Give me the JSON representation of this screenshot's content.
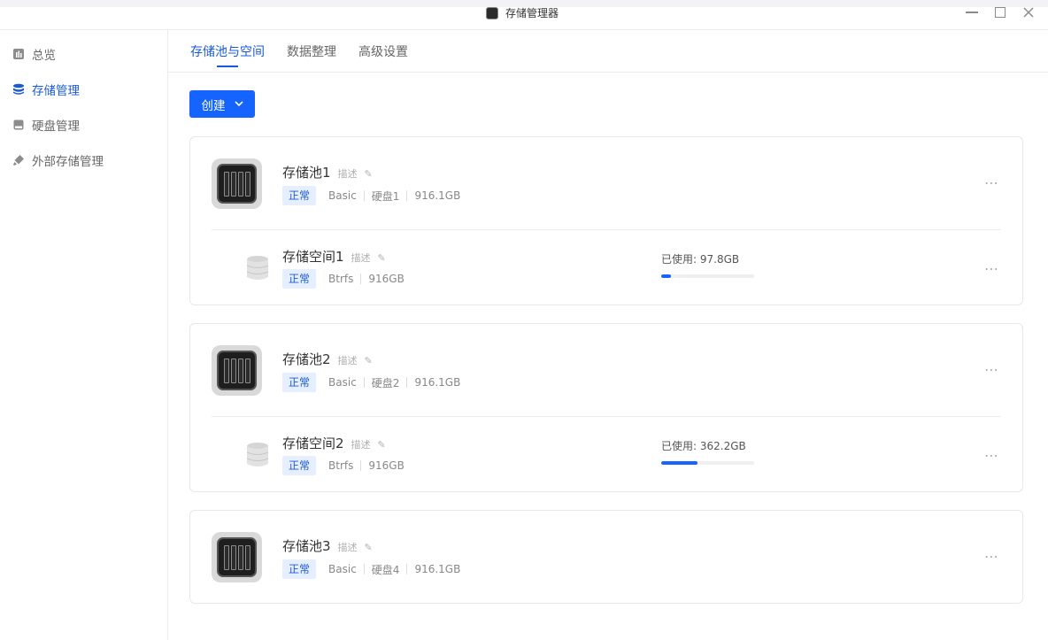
{
  "window": {
    "title": "存储管理器"
  },
  "sidebar": {
    "items": [
      {
        "label": "总览",
        "icon": "chart-icon",
        "active": false
      },
      {
        "label": "存储管理",
        "icon": "database-icon",
        "active": true
      },
      {
        "label": "硬盘管理",
        "icon": "disk-icon",
        "active": false
      },
      {
        "label": "外部存储管理",
        "icon": "usb-icon",
        "active": false
      }
    ]
  },
  "tabs": [
    {
      "label": "存储池与空间",
      "active": true
    },
    {
      "label": "数据整理",
      "active": false
    },
    {
      "label": "高级设置",
      "active": false
    }
  ],
  "toolbar": {
    "create_label": "创建"
  },
  "pools": [
    {
      "name": "存储池1",
      "desc": "描述",
      "status": "正常",
      "raid": "Basic",
      "disks": "硬盘1",
      "size": "916.1GB",
      "volume": {
        "name": "存储空间1",
        "desc": "描述",
        "status": "正常",
        "fs": "Btrfs",
        "size": "916GB",
        "used_label": "已使用: 97.8GB",
        "used_fraction": 0.107
      }
    },
    {
      "name": "存储池2",
      "desc": "描述",
      "status": "正常",
      "raid": "Basic",
      "disks": "硬盘2",
      "size": "916.1GB",
      "volume": {
        "name": "存储空间2",
        "desc": "描述",
        "status": "正常",
        "fs": "Btrfs",
        "size": "916GB",
        "used_label": "已使用: 362.2GB",
        "used_fraction": 0.395
      }
    },
    {
      "name": "存储池3",
      "desc": "描述",
      "status": "正常",
      "raid": "Basic",
      "disks": "硬盘4",
      "size": "916.1GB"
    }
  ],
  "colors": {
    "accent": "#1664ff",
    "badge_bg": "#e6efff",
    "badge_text": "#1a5ad8"
  }
}
